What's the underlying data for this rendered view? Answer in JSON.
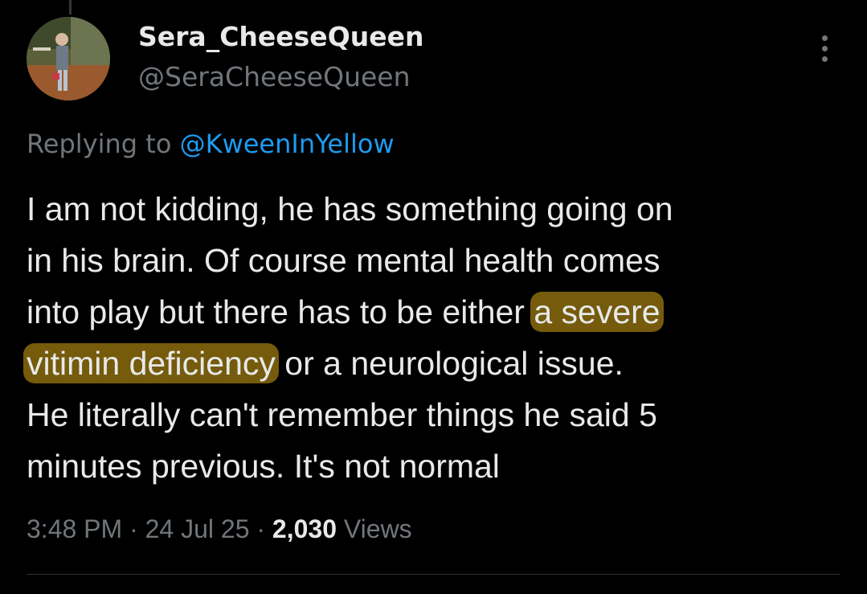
{
  "tweet": {
    "author_name": "Sera_CheeseQueen",
    "author_handle": "@SeraCheeseQueen",
    "replying_prefix": "Replying to ",
    "replying_to": "@KweenInYellow",
    "text_lines": [
      {
        "before": "I am not kidding, he has something going on",
        "highlight": "",
        "after": ""
      },
      {
        "before": "in his brain. Of course mental health comes",
        "highlight": "",
        "after": ""
      },
      {
        "before": "into play but there has to be either ",
        "highlight": "a severe",
        "after": ""
      },
      {
        "before": "",
        "highlight": "vitimin deficiency",
        "after": " or a neurological issue."
      },
      {
        "before": "He literally can't remember things he said 5",
        "highlight": "",
        "after": ""
      },
      {
        "before": "minutes previous. It's not normal",
        "highlight": "",
        "after": ""
      }
    ],
    "time": "3:48 PM",
    "separator": " · ",
    "date": "24 Jul 25",
    "views_count": "2,030",
    "views_label": " Views"
  },
  "icons": {
    "more": "more-options-icon",
    "avatar": "avatar-photo"
  },
  "colors": {
    "background": "#000000",
    "text": "#e7e9ea",
    "muted": "#71767b",
    "link": "#1d9bf0",
    "highlight": "#d5a514"
  }
}
